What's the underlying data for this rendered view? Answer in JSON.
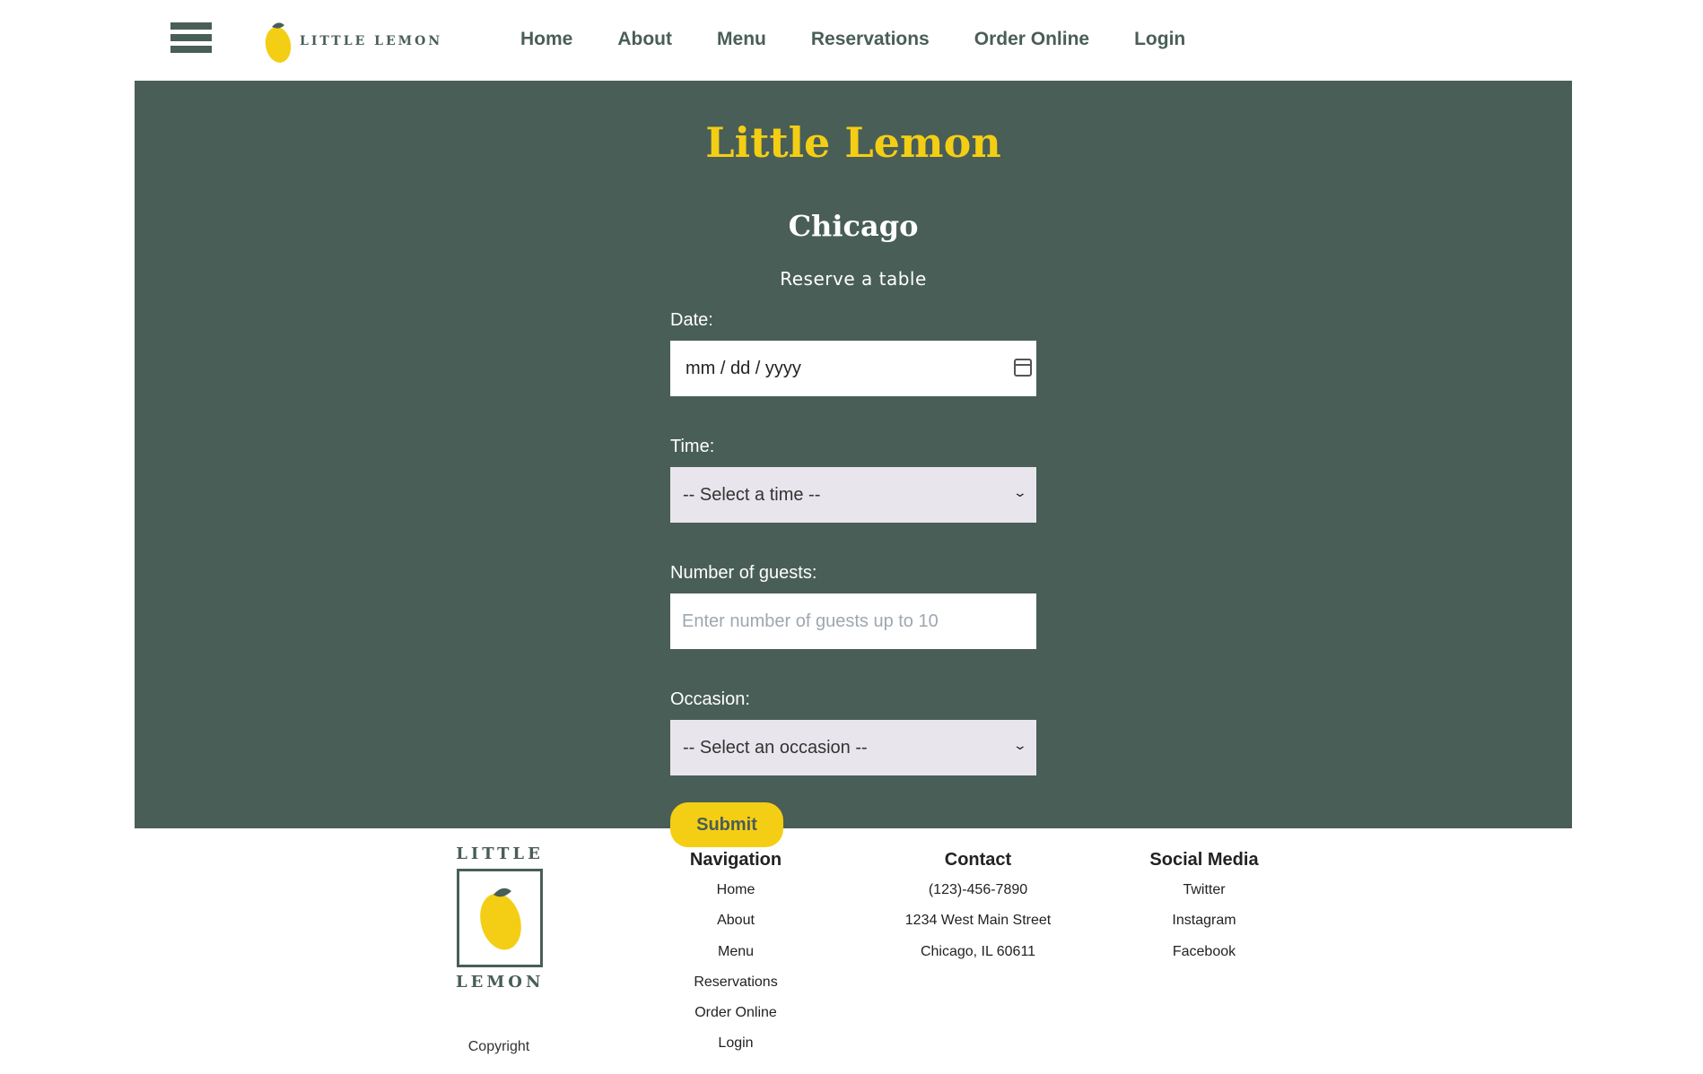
{
  "header": {
    "logo_text": "LITTLE LEMON",
    "nav": [
      "Home",
      "About",
      "Menu",
      "Reservations",
      "Order Online",
      "Login"
    ]
  },
  "hero": {
    "title": "Little Lemon",
    "city": "Chicago",
    "subtitle": "Reserve a table"
  },
  "form": {
    "date_label": "Date:",
    "date_value": "mm / dd / yyyy",
    "time_label": "Time:",
    "time_value": "-- Select a time --",
    "guests_label": "Number of guests:",
    "guests_placeholder": "Enter number of guests up to 10",
    "occasion_label": "Occasion:",
    "occasion_value": "-- Select an occasion --",
    "submit_label": "Submit"
  },
  "footer": {
    "logo_top": "LITTLE",
    "logo_bottom": "LEMON",
    "copyright": "Copyright",
    "navigation": {
      "title": "Navigation",
      "items": [
        "Home",
        "About",
        "Menu",
        "Reservations",
        "Order Online",
        "Login"
      ]
    },
    "contact": {
      "title": "Contact",
      "items": [
        "(123)-456-7890",
        "1234 West Main Street",
        "Chicago, IL 60611"
      ]
    },
    "social": {
      "title": "Social Media",
      "items": [
        "Twitter",
        "Instagram",
        "Facebook"
      ]
    }
  },
  "colors": {
    "primary_green": "#495e57",
    "primary_yellow": "#f4ce14",
    "select_bg": "#e8e6ec"
  }
}
